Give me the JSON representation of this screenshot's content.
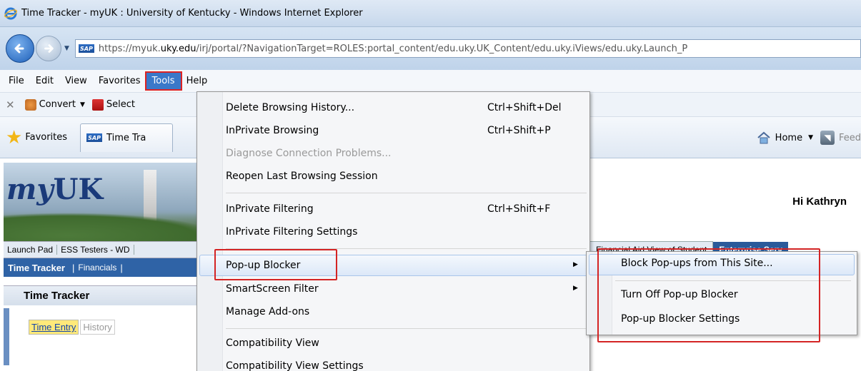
{
  "window": {
    "title": "Time Tracker - myUK : University of Kentucky - Windows Internet Explorer"
  },
  "address": {
    "url_prefix": "https://myuk.",
    "url_domain": "uky.edu",
    "url_rest": "/irj/portal/?NavigationTarget=ROLES:portal_content/edu.uky.UK_Content/edu.uky.iViews/edu.uky.Launch_P"
  },
  "menubar": {
    "items": [
      "File",
      "Edit",
      "View",
      "Favorites",
      "Tools",
      "Help"
    ]
  },
  "toolbar": {
    "convert_label": "Convert",
    "select_label": "Select"
  },
  "favbar": {
    "favorites_label": "Favorites",
    "tab_label": "Time Tra",
    "home_label": "Home",
    "feed_label": "Feed"
  },
  "page": {
    "logo_my": "my",
    "logo_uk": "UK",
    "greeting": "Hi Kathryn",
    "top_tabs": [
      "Launch Pad",
      "ESS Testers - WD"
    ],
    "right_tabs": [
      "Financial Aid View of Student",
      "Enterprise Serv"
    ],
    "subnav_active": "Time Tracker",
    "subnav_next": "Financials",
    "section_title": "Time Tracker",
    "time_entry": "Time Entry",
    "history": "History"
  },
  "tools_menu": {
    "items": [
      {
        "label": "Delete Browsing History...",
        "shortcut": "Ctrl+Shift+Del"
      },
      {
        "label": "InPrivate Browsing",
        "shortcut": "Ctrl+Shift+P"
      },
      {
        "label": "Diagnose Connection Problems..."
      },
      {
        "label": "Reopen Last Browsing Session"
      },
      {
        "label": "InPrivate Filtering",
        "shortcut": "Ctrl+Shift+F"
      },
      {
        "label": "InPrivate Filtering Settings"
      },
      {
        "label": "Pop-up Blocker"
      },
      {
        "label": "SmartScreen Filter"
      },
      {
        "label": "Manage Add-ons"
      },
      {
        "label": "Compatibility View"
      },
      {
        "label": "Compatibility View Settings"
      }
    ]
  },
  "popup_submenu": {
    "items": [
      "Block Pop-ups from This Site...",
      "Turn Off Pop-up Blocker",
      "Pop-up Blocker Settings"
    ]
  },
  "colors": {
    "highlight_red": "#d42424",
    "menu_active_blue": "#3a78c9",
    "subnav_blue": "#2f63a6"
  }
}
